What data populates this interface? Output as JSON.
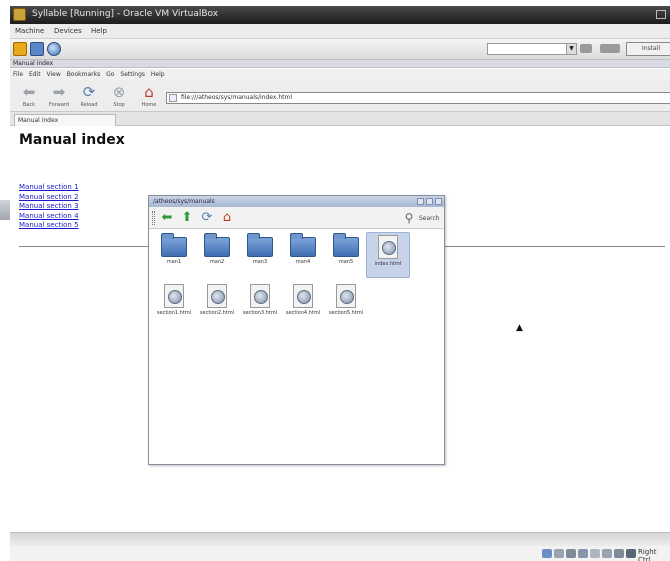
{
  "vbox": {
    "title": "Syllable [Running] - Oracle VM VirtualBox",
    "menus": [
      "Machine",
      "Devices",
      "Help"
    ],
    "toolbar_button": "Install",
    "statusbar": {
      "host_key": "Right Ctrl"
    }
  },
  "guest": {
    "window_title": "Manual index",
    "menus": [
      "File",
      "Edit",
      "View",
      "Bookmarks",
      "Go",
      "Settings",
      "Help"
    ],
    "nav_buttons": [
      {
        "label": "Back",
        "icon": "arrow-left-icon"
      },
      {
        "label": "Forward",
        "icon": "arrow-right-icon"
      },
      {
        "label": "Reload",
        "icon": "reload-icon"
      },
      {
        "label": "Stop",
        "icon": "stop-icon"
      },
      {
        "label": "Home",
        "icon": "home-icon"
      }
    ],
    "address": "file:///atheos/sys/manuals/index.html",
    "tab_label": "Manual index"
  },
  "page": {
    "heading": "Manual index",
    "links": [
      "Manual section 1",
      "Manual section 2",
      "Manual section 3",
      "Manual section 4",
      "Manual section 5"
    ]
  },
  "file_manager": {
    "title": "/atheos/sys/manuals",
    "search_label": "Search",
    "items": [
      {
        "name": "man1",
        "type": "folder"
      },
      {
        "name": "man2",
        "type": "folder"
      },
      {
        "name": "man3",
        "type": "folder"
      },
      {
        "name": "man4",
        "type": "folder"
      },
      {
        "name": "man5",
        "type": "folder"
      },
      {
        "name": "index.html",
        "type": "file",
        "selected": true
      },
      {
        "name": "section1.html",
        "type": "file"
      },
      {
        "name": "section2.html",
        "type": "file"
      },
      {
        "name": "section3.html",
        "type": "file"
      },
      {
        "name": "section4.html",
        "type": "file"
      },
      {
        "name": "section5.html",
        "type": "file"
      }
    ]
  },
  "colors": {
    "link": "#1a1acc",
    "folder": "#4f7fc2",
    "selection": "#c7d3ea"
  }
}
